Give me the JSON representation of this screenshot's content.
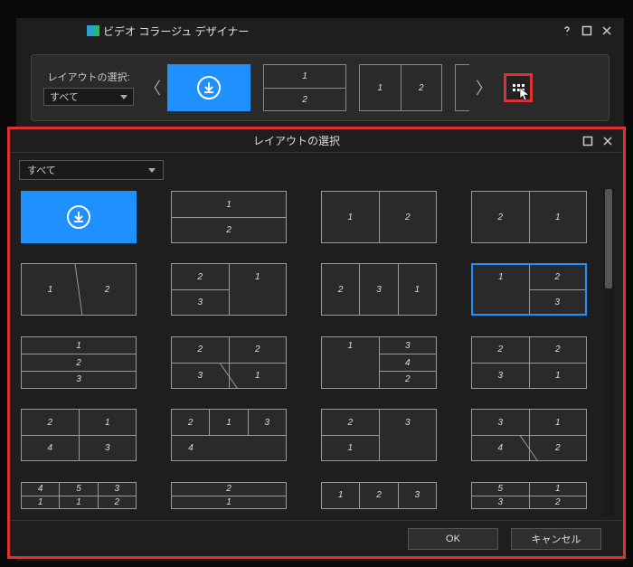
{
  "main_window": {
    "title": "ビデオ コラージュ デザイナー",
    "help_icon": "help-icon",
    "maximize_icon": "maximize-icon",
    "close_icon": "close-icon"
  },
  "strip": {
    "label": "レイアウトの選択:",
    "filter_value": "すべて",
    "prev_icon": "chevron-left-icon",
    "next_icon": "chevron-right-icon",
    "expand_icon": "grid-icon",
    "thumbs": [
      {
        "type": "download",
        "selected": true
      },
      {
        "type": "layout",
        "cells": [
          [
            "1"
          ],
          [
            "2"
          ]
        ]
      },
      {
        "type": "layout",
        "cells": [
          [
            "1",
            "2"
          ]
        ]
      },
      {
        "type": "layout-edge"
      }
    ]
  },
  "dialog": {
    "title": "レイアウトの選択",
    "filter_value": "すべて",
    "ok_label": "OK",
    "cancel_label": "キャンセル",
    "maximize_icon": "maximize-icon",
    "close_icon": "close-icon",
    "layouts": [
      {
        "id": "dl",
        "type": "download",
        "selected": true
      },
      {
        "id": "L2v",
        "rows": [
          [
            "1"
          ],
          [
            "2"
          ]
        ]
      },
      {
        "id": "L2h",
        "rows": [
          [
            "1",
            "2"
          ]
        ]
      },
      {
        "id": "L2hr",
        "rows": [
          [
            "2",
            "1"
          ]
        ]
      },
      {
        "id": "L2diag",
        "rows": [
          [
            "1",
            "2"
          ]
        ],
        "diag": true
      },
      {
        "id": "L3a",
        "rows": [
          [
            "2",
            "1"
          ],
          [
            "3",
            "1"
          ]
        ],
        "mergeRight": true
      },
      {
        "id": "L3b",
        "rows": [
          [
            "2",
            "3",
            "1"
          ]
        ]
      },
      {
        "id": "L3c",
        "rows": [
          [
            "1",
            "2"
          ],
          [
            "1",
            "3"
          ]
        ],
        "mergeLeft": true,
        "highlight": true
      },
      {
        "id": "L3rows",
        "rows": [
          [
            "1"
          ],
          [
            "2"
          ],
          [
            "3"
          ]
        ]
      },
      {
        "id": "L3d",
        "rows": [
          [
            "2",
            "2"
          ],
          [
            "3",
            "1"
          ]
        ],
        "diag2": true
      },
      {
        "id": "L4a",
        "rows": [
          [
            "1",
            "3"
          ],
          [
            "1",
            "4"
          ],
          [
            "1",
            "2"
          ]
        ],
        "mergeLeft": true,
        "thin": true
      },
      {
        "id": "L4b",
        "rows": [
          [
            "2",
            "2"
          ],
          [
            "3",
            "1"
          ]
        ]
      },
      {
        "id": "L4c",
        "rows": [
          [
            "2",
            "1"
          ],
          [
            "4",
            "3"
          ]
        ]
      },
      {
        "id": "L4d",
        "rows": [
          [
            "2",
            "1",
            "3"
          ],
          [
            "4",
            "4",
            "4"
          ]
        ],
        "mergeBottom": true
      },
      {
        "id": "L4e",
        "rows": [
          [
            "2",
            "3"
          ],
          [
            "1",
            "3"
          ]
        ],
        "mergeRight": true
      },
      {
        "id": "L4f",
        "rows": [
          [
            "3",
            "1"
          ],
          [
            "4",
            "2"
          ]
        ],
        "diag2": true
      },
      {
        "id": "L5a",
        "rows": [
          [
            "4",
            "5",
            "3"
          ],
          [
            "1",
            "1",
            "2"
          ]
        ],
        "half": true
      },
      {
        "id": "L5b",
        "rows": [
          [
            "2"
          ],
          [
            "1"
          ]
        ],
        "half": true
      },
      {
        "id": "L5c",
        "rows": [
          [
            "1",
            "2",
            "3"
          ]
        ],
        "half": true
      },
      {
        "id": "L5d",
        "rows": [
          [
            "5",
            "1"
          ],
          [
            "3",
            "2"
          ]
        ],
        "half": true
      }
    ]
  }
}
